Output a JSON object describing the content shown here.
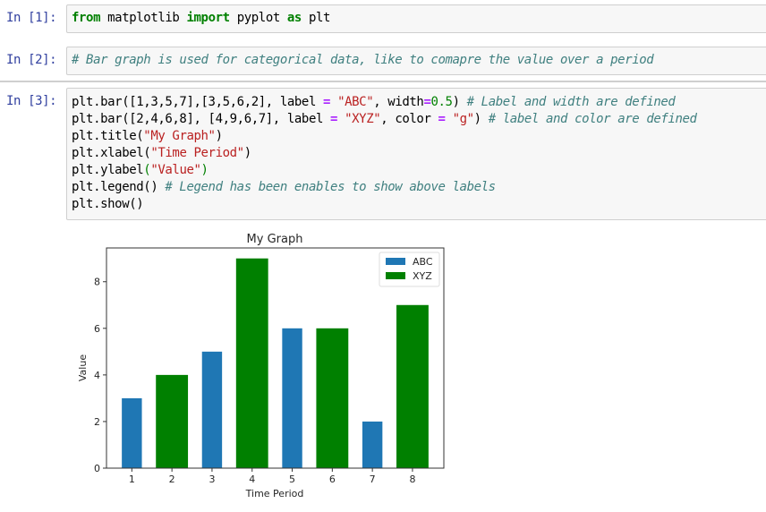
{
  "notebook": {
    "cells": [
      {
        "prompt": "In [1]:",
        "lines": [
          [
            {
              "t": "kw",
              "v": "from"
            },
            {
              "t": "",
              "v": " matplotlib "
            },
            {
              "t": "kw",
              "v": "import"
            },
            {
              "t": "",
              "v": " pyplot "
            },
            {
              "t": "kw",
              "v": "as"
            },
            {
              "t": "",
              "v": " plt"
            }
          ]
        ]
      },
      {
        "prompt": "In [2]:",
        "lines": [
          [
            {
              "t": "cm",
              "v": "# Bar graph is used for categorical data, like to comapre the value over a period"
            }
          ]
        ]
      },
      {
        "prompt": "In [3]:",
        "lines": [
          [
            {
              "t": "",
              "v": "plt.bar([1,3,5,7],[3,5,6,2], label "
            },
            {
              "t": "op",
              "v": "="
            },
            {
              "t": "",
              "v": " "
            },
            {
              "t": "str",
              "v": "\"ABC\""
            },
            {
              "t": "",
              "v": ", width"
            },
            {
              "t": "op",
              "v": "="
            },
            {
              "t": "num",
              "v": "0.5"
            },
            {
              "t": "",
              "v": ") "
            },
            {
              "t": "cm",
              "v": "# Label and width are defined"
            }
          ],
          [
            {
              "t": "",
              "v": "plt.bar([2,4,6,8], [4,9,6,7], label "
            },
            {
              "t": "op",
              "v": "="
            },
            {
              "t": "",
              "v": " "
            },
            {
              "t": "str",
              "v": "\"XYZ\""
            },
            {
              "t": "",
              "v": ", color "
            },
            {
              "t": "op",
              "v": "="
            },
            {
              "t": "",
              "v": " "
            },
            {
              "t": "str",
              "v": "\"g\""
            },
            {
              "t": "",
              "v": ") "
            },
            {
              "t": "cm",
              "v": "# label and color are defined"
            }
          ],
          [
            {
              "t": "",
              "v": "plt.title("
            },
            {
              "t": "str",
              "v": "\"My Graph\""
            },
            {
              "t": "",
              "v": ")"
            }
          ],
          [
            {
              "t": "",
              "v": "plt.xlabel("
            },
            {
              "t": "str",
              "v": "\"Time Period\""
            },
            {
              "t": "",
              "v": ")"
            }
          ],
          [
            {
              "t": "",
              "v": "plt.ylabel"
            },
            {
              "t": "bm",
              "v": "("
            },
            {
              "t": "str",
              "v": "\"Value\""
            },
            {
              "t": "bm",
              "v": ")"
            }
          ],
          [
            {
              "t": "",
              "v": "plt.legend() "
            },
            {
              "t": "cm",
              "v": "# Legend has been enables to show above labels"
            }
          ],
          [
            {
              "t": "",
              "v": "plt.show()"
            }
          ]
        ]
      }
    ]
  },
  "chart_data": {
    "type": "bar",
    "title": "My Graph",
    "xlabel": "Time Period",
    "ylabel": "Value",
    "xlim": [
      0.3675,
      8.7825
    ],
    "ylim": [
      0,
      9.45
    ],
    "xticks": [
      1,
      2,
      3,
      4,
      5,
      6,
      7,
      8
    ],
    "yticks": [
      0,
      2,
      4,
      6,
      8
    ],
    "grid": false,
    "legend_position": "top-right",
    "series": [
      {
        "name": "ABC",
        "color": "#1f77b4",
        "bar_width": 0.5,
        "x": [
          1,
          3,
          5,
          7
        ],
        "values": [
          3,
          5,
          6,
          2
        ]
      },
      {
        "name": "XYZ",
        "color": "#008000",
        "bar_width": 0.8,
        "x": [
          2,
          4,
          6,
          8
        ],
        "values": [
          4,
          9,
          6,
          7
        ]
      }
    ]
  }
}
